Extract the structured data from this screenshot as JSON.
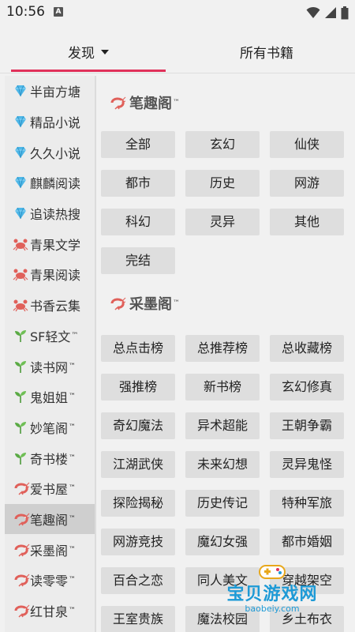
{
  "status_bar": {
    "time": "10:56",
    "notif_icon": "A"
  },
  "tabs": [
    {
      "label": "发现",
      "dropdown": true
    },
    {
      "label": "所有书籍",
      "dropdown": false
    }
  ],
  "colors": {
    "accent": "#e0315a",
    "diamond": "#4fb8e8",
    "crab": "#e0605a",
    "sprout": "#4c9a3a"
  },
  "sidebar": {
    "items": [
      {
        "label": "半亩方塘",
        "icon": "diamond-icon",
        "tm": false
      },
      {
        "label": "精品小说",
        "icon": "diamond-icon",
        "tm": false
      },
      {
        "label": "久久小说",
        "icon": "diamond-icon",
        "tm": false
      },
      {
        "label": "麒麟阅读",
        "icon": "diamond-icon",
        "tm": false
      },
      {
        "label": "追读热搜",
        "icon": "diamond-icon",
        "tm": false
      },
      {
        "label": "青果文学",
        "icon": "crab-icon",
        "tm": false
      },
      {
        "label": "青果阅读",
        "icon": "crab-icon",
        "tm": false
      },
      {
        "label": "书香云集",
        "icon": "crab-icon",
        "tm": false
      },
      {
        "label": "SF轻文",
        "icon": "sprout-icon",
        "tm": true
      },
      {
        "label": "读书网",
        "icon": "sprout-icon",
        "tm": true
      },
      {
        "label": "鬼姐姐",
        "icon": "sprout-icon",
        "tm": true
      },
      {
        "label": "妙笔阁",
        "icon": "sprout-icon",
        "tm": true
      },
      {
        "label": "奇书楼",
        "icon": "sprout-icon",
        "tm": true
      },
      {
        "label": "爱书屋",
        "icon": "shrimp-icon",
        "tm": true
      },
      {
        "label": "笔趣阁",
        "icon": "shrimp-icon",
        "tm": true,
        "active": true
      },
      {
        "label": "采墨阁",
        "icon": "shrimp-icon",
        "tm": true
      },
      {
        "label": "读零零",
        "icon": "shrimp-icon",
        "tm": true
      },
      {
        "label": "红甘泉",
        "icon": "shrimp-icon",
        "tm": true
      }
    ]
  },
  "sections": [
    {
      "title": "笔趣阁",
      "tm": "™",
      "icon": "shrimp-icon",
      "buttons": [
        "全部",
        "玄幻",
        "仙侠",
        "都市",
        "历史",
        "网游",
        "科幻",
        "灵异",
        "其他",
        "完结"
      ]
    },
    {
      "title": "采墨阁",
      "tm": "™",
      "icon": "shrimp-icon",
      "buttons": [
        "总点击榜",
        "总推荐榜",
        "总收藏榜",
        "强推榜",
        "新书榜",
        "玄幻修真",
        "奇幻魔法",
        "异术超能",
        "王朝争霸",
        "江湖武侠",
        "未来幻想",
        "灵异鬼怪",
        "探险揭秘",
        "历史传记",
        "特种军旅",
        "网游竞技",
        "魔幻女强",
        "都市婚姻",
        "百合之恋",
        "同人美文",
        "穿越架空",
        "王室贵族",
        "魔法校园",
        "乡土布衣"
      ]
    }
  ],
  "watermark": {
    "text": "宝贝游戏网",
    "url": "baobeiy.com"
  }
}
